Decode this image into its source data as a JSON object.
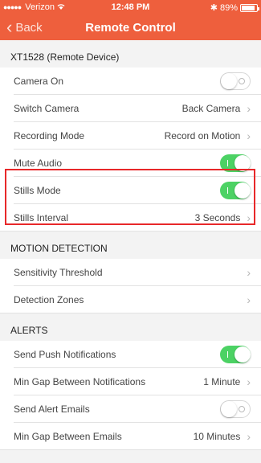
{
  "status_bar": {
    "carrier": "Verizon",
    "time": "12:48 PM",
    "battery": "89%",
    "battery_level": 0.89
  },
  "nav": {
    "back_label": "Back",
    "title": "Remote Control"
  },
  "sections": {
    "device": {
      "header": "XT1528 (Remote Device)",
      "camera_on": {
        "label": "Camera On",
        "state": "off"
      },
      "switch_camera": {
        "label": "Switch Camera",
        "value": "Back Camera"
      },
      "recording_mode": {
        "label": "Recording Mode",
        "value": "Record on Motion"
      },
      "mute_audio": {
        "label": "Mute Audio",
        "state": "on"
      },
      "stills_mode": {
        "label": "Stills Mode",
        "state": "on"
      },
      "stills_interval": {
        "label": "Stills Interval",
        "value": "3 Seconds"
      }
    },
    "motion": {
      "header": "MOTION DETECTION",
      "sensitivity": {
        "label": "Sensitivity Threshold"
      },
      "zones": {
        "label": "Detection Zones"
      }
    },
    "alerts": {
      "header": "ALERTS",
      "push": {
        "label": "Send Push Notifications",
        "state": "on"
      },
      "gap_notifications": {
        "label": "Min Gap Between Notifications",
        "value": "1 Minute"
      },
      "alert_emails": {
        "label": "Send Alert Emails",
        "state": "off"
      },
      "gap_emails": {
        "label": "Min Gap Between Emails",
        "value": "10 Minutes"
      }
    }
  },
  "colors": {
    "accent": "#ee5f3d",
    "toggle_on": "#4cd264",
    "highlight": "#e8282a"
  }
}
